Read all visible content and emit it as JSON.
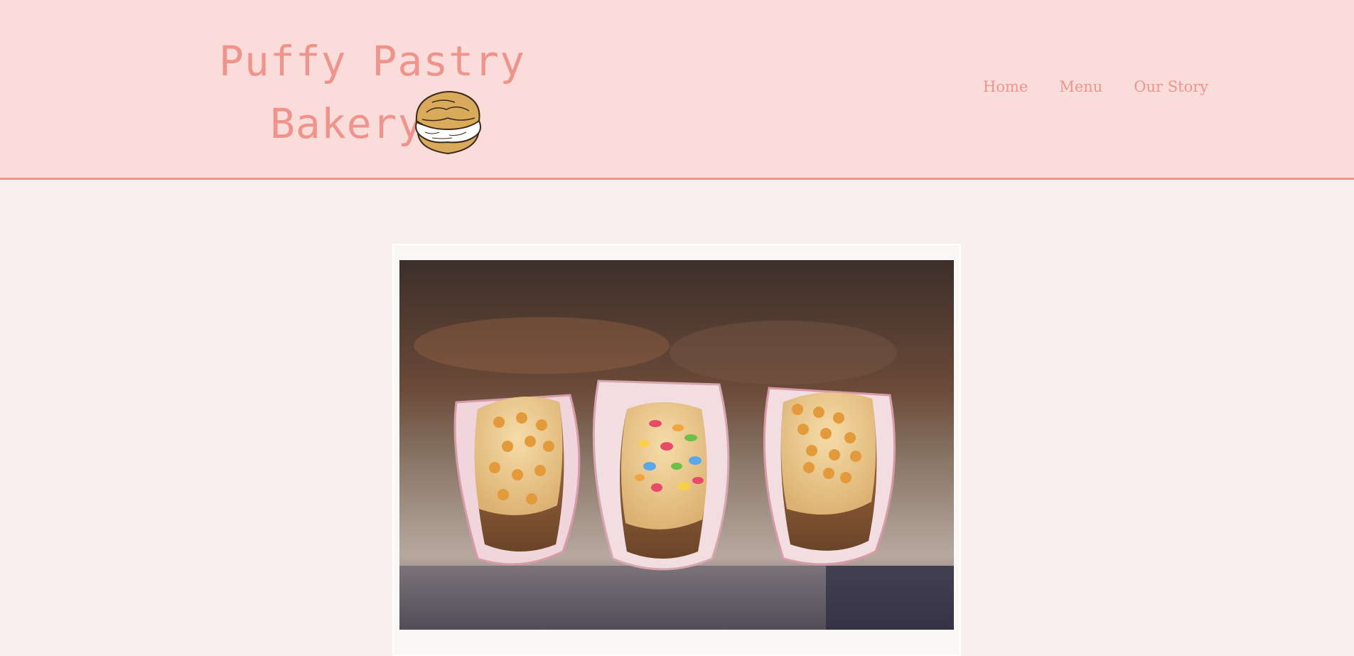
{
  "brand": {
    "line1": "Puffy Pastry",
    "line2": "Bakery",
    "icon": "cream-puff-icon"
  },
  "nav": {
    "items": [
      {
        "label": "Home"
      },
      {
        "label": "Menu"
      },
      {
        "label": "Our Story"
      }
    ]
  },
  "hero": {
    "image": "eclairs-photo"
  },
  "colors": {
    "header_bg": "#fadcdb",
    "accent": "#ef948c",
    "page_bg": "#f9eeed"
  }
}
